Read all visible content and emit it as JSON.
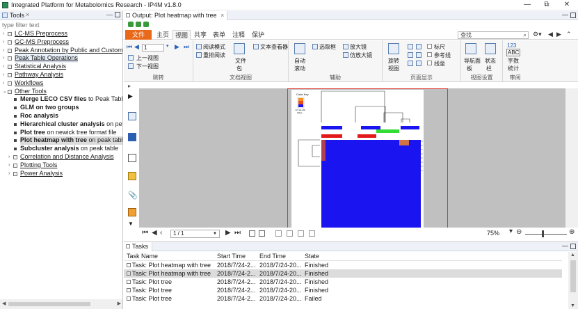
{
  "window": {
    "title": "Integrated Platform for Metabolomics Research - IP4M v1.8.0",
    "minimize": "—",
    "maximize": "⧉",
    "close": "✕"
  },
  "tools": {
    "tab_label": "Tools",
    "close_glyph": "×",
    "minimize_glyph": "—",
    "filter_placeholder": "type filter text",
    "items": [
      {
        "label": "LC-MS Preprocess",
        "level": 0,
        "state": "collapsed"
      },
      {
        "label": "GC-MS Preprocess",
        "level": 0,
        "state": "collapsed"
      },
      {
        "label": "Peak Annotation by Public and Custom Li",
        "level": 0,
        "state": "collapsed"
      },
      {
        "label": "Peak Table Operations",
        "level": 0,
        "state": "collapsed",
        "highlight": true
      },
      {
        "label": "Statistical Analysis",
        "level": 0,
        "state": "collapsed"
      },
      {
        "label": "Pathway Analysis",
        "level": 0,
        "state": "collapsed"
      },
      {
        "label": "Workflows",
        "level": 0,
        "state": "collapsed"
      },
      {
        "label": "Other Tools",
        "level": 0,
        "state": "expanded"
      },
      {
        "bold": "Merge LECO CSV files",
        "rest": " to Peak Table",
        "level": 1
      },
      {
        "bold": "GLM on two groups",
        "rest": "",
        "level": 1
      },
      {
        "bold": "Roc analysis",
        "rest": "",
        "level": 1
      },
      {
        "bold": "Hierarchical cluster analysis",
        "rest": " on peak ta",
        "level": 1
      },
      {
        "bold": "Plot tree",
        "rest": " on newick tree format file",
        "level": 1
      },
      {
        "bold": "Plot heatmap with tree",
        "rest": " on peak table",
        "level": 1,
        "selected": true
      },
      {
        "bold": "Subcluster analysis",
        "rest": " on peak table",
        "level": 1
      },
      {
        "label": "Correlation and Distance Analysis",
        "level": 1,
        "state": "collapsed"
      },
      {
        "label": "Plotting Tools",
        "level": 1,
        "state": "collapsed"
      },
      {
        "label": "Power Analysis",
        "level": 1,
        "state": "collapsed"
      }
    ]
  },
  "output": {
    "tab_label": "Output: Plot heatmap with tree",
    "close_glyph": "×",
    "minimize_glyph": "—"
  },
  "ribbon": {
    "tabs": [
      "文件",
      "主页",
      "视图",
      "共享",
      "表单",
      "注释",
      "保护"
    ],
    "active_tab": "视图",
    "search_placeholder": "查找",
    "page_value": "1",
    "groups": {
      "jump": "跳转",
      "docview": "文档视图",
      "assist": "辅助",
      "page_display": "页面显示",
      "view_settings": "视图设置",
      "review": "审阅"
    },
    "items": {
      "prev_view": "上一视图",
      "next_view": "下一视图",
      "read_mode": "阅读模式",
      "reflow_read": "重排阅读",
      "text_viewer": "文本查看器",
      "file_pkg_1": "文件",
      "file_pkg_2": "包",
      "auto_scroll_1": "自动",
      "auto_scroll_2": "滚动",
      "select_box": "选取框",
      "magnifier": "放大镜",
      "loupe": "仿放大镜",
      "rotate_1": "旋转",
      "rotate_2": "视图",
      "ruler": "标尺",
      "ref_line": "参考线",
      "guide": "线坐",
      "nav_1": "导航面",
      "nav_2": "板",
      "status_1": "状态",
      "status_2": "栏",
      "wordcount_num": "123",
      "wordcount_abc": "ABC",
      "wordcount_1": "字数",
      "wordcount_2": "统计"
    }
  },
  "viewer": {
    "page_indicator": "1 / 1",
    "zoom": "75%",
    "zoom_level_percent": 75,
    "heatmap": {
      "color_key_title": "Color Key",
      "color_key_ticks": "-5 0 2e+09",
      "color_key_value": "Value",
      "colors": {
        "high": "#1a14f0",
        "mid": "#e3501e",
        "top": "#ff8c1a",
        "green": "#33dd33",
        "red": "#e31a1a"
      }
    }
  },
  "tasks": {
    "tab_label": "Tasks",
    "columns": [
      "Task Name",
      "Start Time",
      "End Time",
      "State"
    ],
    "rows": [
      {
        "name": "Task: Plot heatmap with tree",
        "start": "2018/7/24-2...",
        "end": "2018/7/24-20...",
        "state": "Finished"
      },
      {
        "name": "Task: Plot heatmap with tree",
        "start": "2018/7/24-2...",
        "end": "2018/7/24-20...",
        "state": "Finished",
        "selected": true
      },
      {
        "name": "Task: Plot tree",
        "start": "2018/7/24-2...",
        "end": "2018/7/24-20...",
        "state": "Finished"
      },
      {
        "name": "Task: Plot tree",
        "start": "2018/7/24-2...",
        "end": "2018/7/24-20...",
        "state": "Finished"
      },
      {
        "name": "Task: Plot tree",
        "start": "2018/7/24-2...",
        "end": "2018/7/24-20...",
        "state": "Failed"
      }
    ]
  }
}
